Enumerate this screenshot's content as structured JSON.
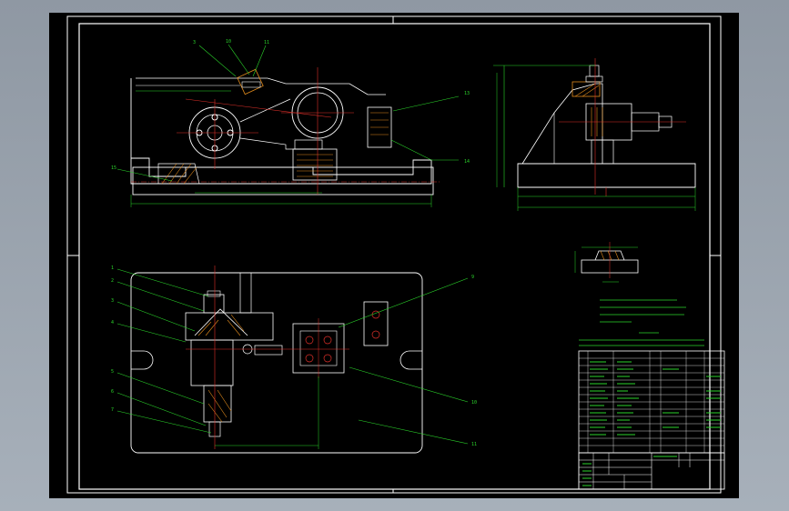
{
  "drawing": {
    "background": "#000000",
    "frame_color": "#ffffff",
    "dimension_color": "#2bd52b",
    "centerline_color": "#e0302a",
    "hatch_color": "#e08a1c",
    "callout_labels_top": [
      "3",
      "4",
      "5",
      "6",
      "7",
      "8"
    ],
    "callout_labels_bottom": [
      "1",
      "2",
      "3",
      "4",
      "5",
      "6",
      "7",
      "8"
    ],
    "callout_labels_right": [
      "9",
      "10",
      "11"
    ]
  }
}
